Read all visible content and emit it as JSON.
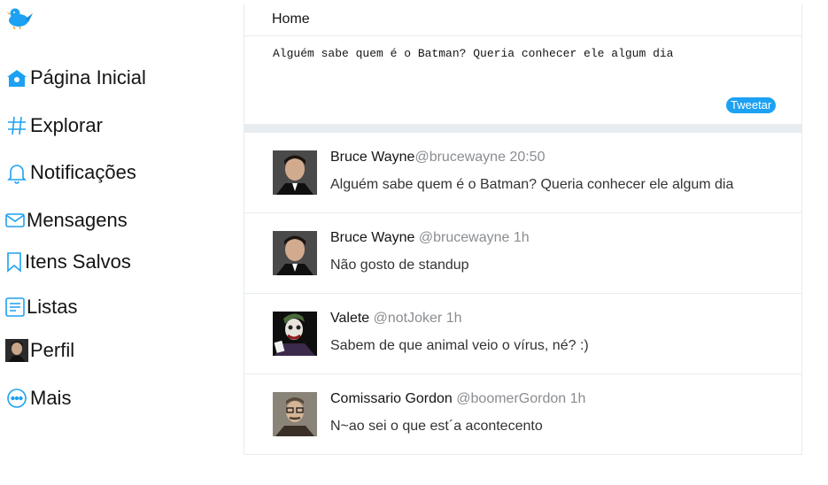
{
  "brand": {
    "logo_icon": "bird-logo-icon",
    "accent": "#1da1f2"
  },
  "sidebar": {
    "items": [
      {
        "label": "Página Inicial",
        "icon": "home-icon"
      },
      {
        "label": "Explorar",
        "icon": "hashtag-icon"
      },
      {
        "label": "Notificações",
        "icon": "bell-icon"
      },
      {
        "label": "Mensagens",
        "icon": "envelope-icon"
      },
      {
        "label": "Itens Salvos",
        "icon": "bookmark-icon"
      },
      {
        "label": "Listas",
        "icon": "list-icon"
      },
      {
        "label": "Perfil",
        "icon": "profile-avatar"
      },
      {
        "label": "Mais",
        "icon": "more-icon"
      }
    ]
  },
  "main": {
    "title": "Home",
    "composer": {
      "value": "Alguém sabe quem é o Batman? Queria conhecer ele algum dia",
      "button_label": "Tweetar"
    },
    "tweets": [
      {
        "name": "Bruce Wayne",
        "handle": "@brucewayne",
        "time": "20:50",
        "text": "Alguém sabe quem é o Batman? Queria conhecer ele algum dia"
      },
      {
        "name": "Bruce Wayne",
        "handle": "@brucewayne",
        "time": "1h",
        "text": "Não gosto de standup"
      },
      {
        "name": "Valete",
        "handle": "@notJoker",
        "time": "1h",
        "text": "Sabem de que animal veio o vírus, né? :)"
      },
      {
        "name": "Comissario Gordon",
        "handle": "@boomerGordon",
        "time": "1h",
        "text": "N~ao sei o que est´a acontecento"
      }
    ]
  }
}
